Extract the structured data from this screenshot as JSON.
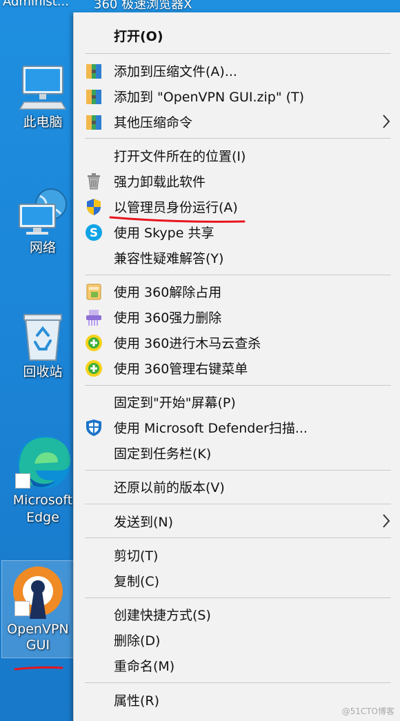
{
  "desktop": {
    "top_labels": [
      "Administ...",
      "360 极速浏览器X"
    ],
    "icons": [
      {
        "name": "此电脑"
      },
      {
        "name": "网络"
      },
      {
        "name": "回收站"
      },
      {
        "name_line1": "Microsoft",
        "name_line2": "Edge"
      },
      {
        "name_line1": "OpenVPN",
        "name_line2": "GUI"
      }
    ]
  },
  "context_menu": {
    "items": [
      {
        "label": "打开(O)",
        "icon": "none"
      },
      {
        "label": "添加到压缩文件(A)...",
        "icon": "archive-icon"
      },
      {
        "label": "添加到 \"OpenVPN GUI.zip\" (T)",
        "icon": "archive-icon"
      },
      {
        "label": "其他压缩命令",
        "icon": "archive-icon",
        "submenu": true
      },
      {
        "label": "打开文件所在的位置(I)",
        "icon": "none"
      },
      {
        "label": "强力卸载此软件",
        "icon": "trash-icon"
      },
      {
        "label": "以管理员身份运行(A)",
        "icon": "uac-shield-icon"
      },
      {
        "label": "使用 Skype 共享",
        "icon": "skype-icon"
      },
      {
        "label": "兼容性疑难解答(Y)",
        "icon": "none"
      },
      {
        "label": "使用 360解除占用",
        "icon": "unlock-icon"
      },
      {
        "label": "使用 360强力删除",
        "icon": "shredder-icon"
      },
      {
        "label": "使用 360进行木马云查杀",
        "icon": "360-icon"
      },
      {
        "label": "使用 360管理右键菜单",
        "icon": "360-icon"
      },
      {
        "label": "固定到\"开始\"屏幕(P)",
        "icon": "none"
      },
      {
        "label": "使用 Microsoft Defender扫描...",
        "icon": "defender-icon"
      },
      {
        "label": "固定到任务栏(K)",
        "icon": "none"
      },
      {
        "label": "还原以前的版本(V)",
        "icon": "none"
      },
      {
        "label": "发送到(N)",
        "icon": "none",
        "submenu": true
      },
      {
        "label": "剪切(T)",
        "icon": "none"
      },
      {
        "label": "复制(C)",
        "icon": "none"
      },
      {
        "label": "创建快捷方式(S)",
        "icon": "none"
      },
      {
        "label": "删除(D)",
        "icon": "none"
      },
      {
        "label": "重命名(M)",
        "icon": "none"
      },
      {
        "label": "属性(R)",
        "icon": "none"
      }
    ]
  },
  "watermark": "@51CTO博客",
  "colors": {
    "desktop": "#1c86d8",
    "menu_bg": "#f2f2f2",
    "annotation_red": "#e8141e"
  }
}
